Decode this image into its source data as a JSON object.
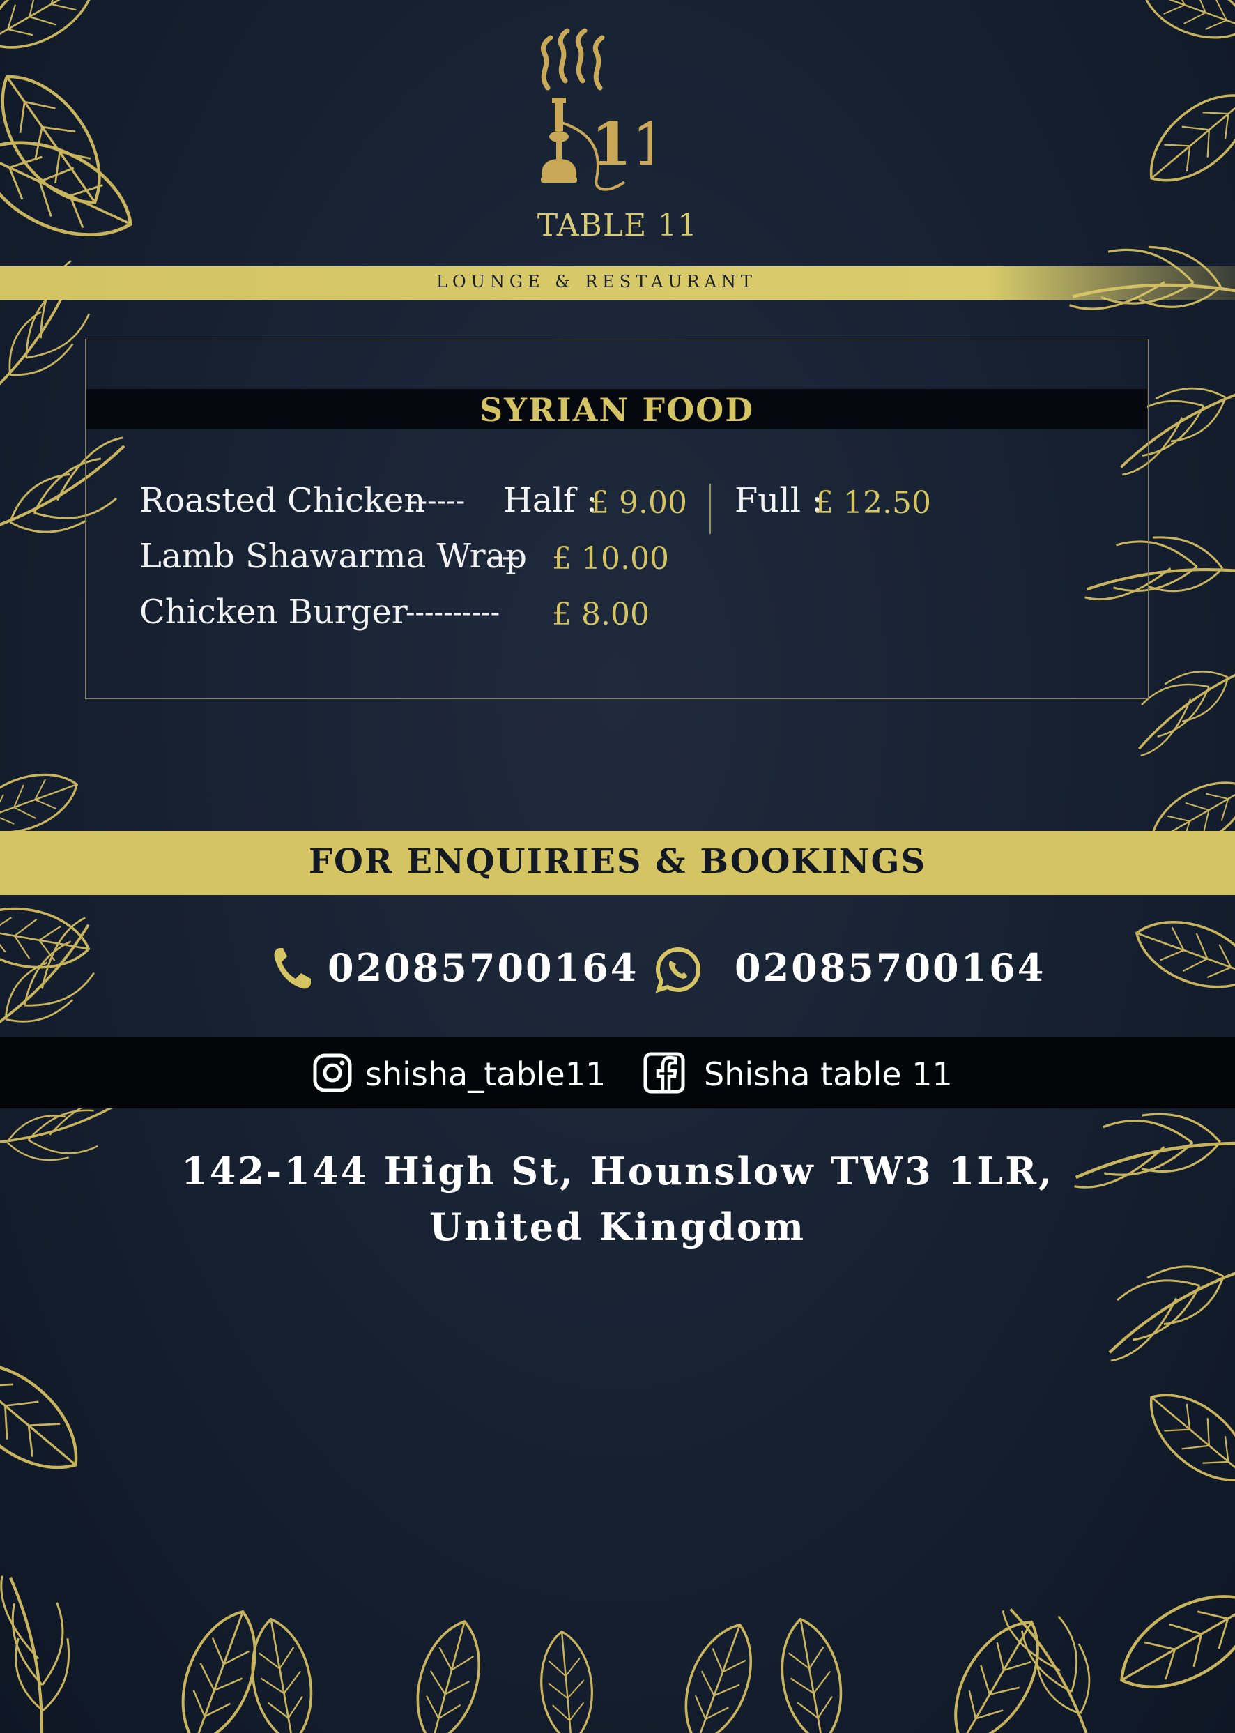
{
  "brand": {
    "logo_icon": "hookah-logo-icon",
    "logo_number": "11",
    "name": "TABLE 11",
    "tagline": "LOUNGE & RESTAURANT"
  },
  "menu": {
    "section_title": "SYRIAN FOOD",
    "items": [
      {
        "name": "Roasted Chicken",
        "dashes": "------",
        "half_label": "Half :",
        "half_price": "£ 9.00",
        "full_label": "Full :",
        "full_price": "£ 12.50"
      },
      {
        "name": "Lamb Shawarma Wrap",
        "dashes": "---",
        "price": "£ 10.00"
      },
      {
        "name": "Chicken Burger",
        "dashes": "----------",
        "price": "£ 8.00"
      }
    ]
  },
  "enquiries": {
    "title": "FOR ENQUIRIES & BOOKINGS",
    "phone": {
      "icon": "phone-icon",
      "number": "02085700164"
    },
    "whatsapp": {
      "icon": "whatsapp-icon",
      "number": "02085700164"
    },
    "instagram": {
      "icon": "instagram-icon",
      "handle": "shisha_table11"
    },
    "facebook": {
      "icon": "facebook-icon",
      "handle": "Shisha table 11"
    }
  },
  "address": {
    "line1": "142-144 High St, Hounslow TW3 1LR,",
    "line2": "United Kingdom"
  },
  "colors": {
    "gold": "#d4c463",
    "background": "#172233",
    "dark_band": "#05080e",
    "text_light": "#ffffff"
  }
}
